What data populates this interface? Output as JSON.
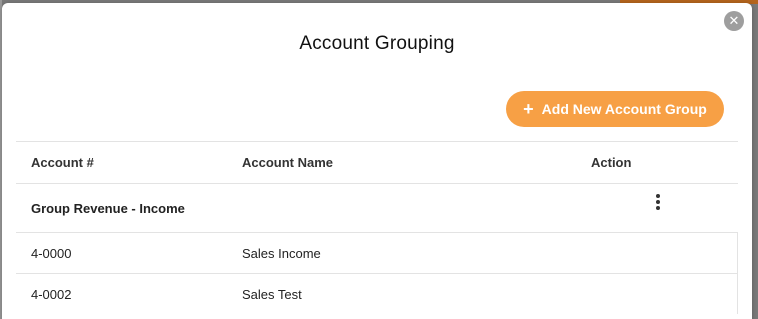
{
  "modal": {
    "title": "Account Grouping",
    "close_icon": "close-icon",
    "add_button": {
      "icon": "plus-icon",
      "label": "Add New Account Group",
      "color": "#f7a045"
    }
  },
  "table": {
    "columns": [
      "Account #",
      "Account Name",
      "Action"
    ],
    "group": {
      "label": "Group Revenue - Income",
      "action_icon": "kebab-menu-icon"
    },
    "rows": [
      {
        "account": "4-0000",
        "name": "Sales Income"
      },
      {
        "account": "4-0002",
        "name": "Sales Test"
      }
    ]
  }
}
